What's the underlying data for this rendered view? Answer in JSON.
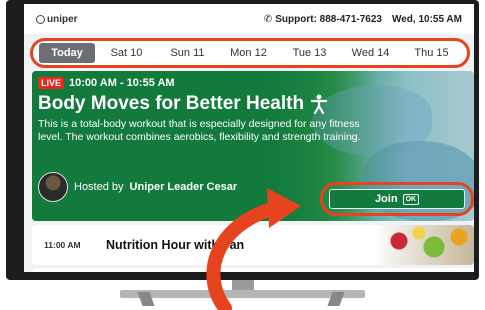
{
  "brand": {
    "logo_text": "uniper"
  },
  "topbar": {
    "support": "Support: 888-471-7623",
    "datetime": "Wed, 10:55 AM"
  },
  "tabs": [
    {
      "label": "Today",
      "active": true
    },
    {
      "label": "Sat 10"
    },
    {
      "label": "Sun 11"
    },
    {
      "label": "Mon 12"
    },
    {
      "label": "Tue 13"
    },
    {
      "label": "Wed 14"
    },
    {
      "label": "Thu 15"
    }
  ],
  "hero": {
    "live_badge": "LIVE",
    "time": "10:00 AM - 10:55 AM",
    "title": "Body Moves for Better Health",
    "description": "This is a total-body workout that is especially designed for any fitness level. The workout combines aerobics, flexibility and strength training.",
    "hosted_by": "Hosted by",
    "host_name": "Uniper Leader Cesar",
    "join_label": "Join",
    "ok_label": "OK"
  },
  "next": {
    "time": "11:00 AM",
    "title": "Nutrition Hour with Jan"
  },
  "colors": {
    "accent": "#e8431f",
    "brand_green": "#127a3c",
    "live_red": "#e8281b"
  }
}
